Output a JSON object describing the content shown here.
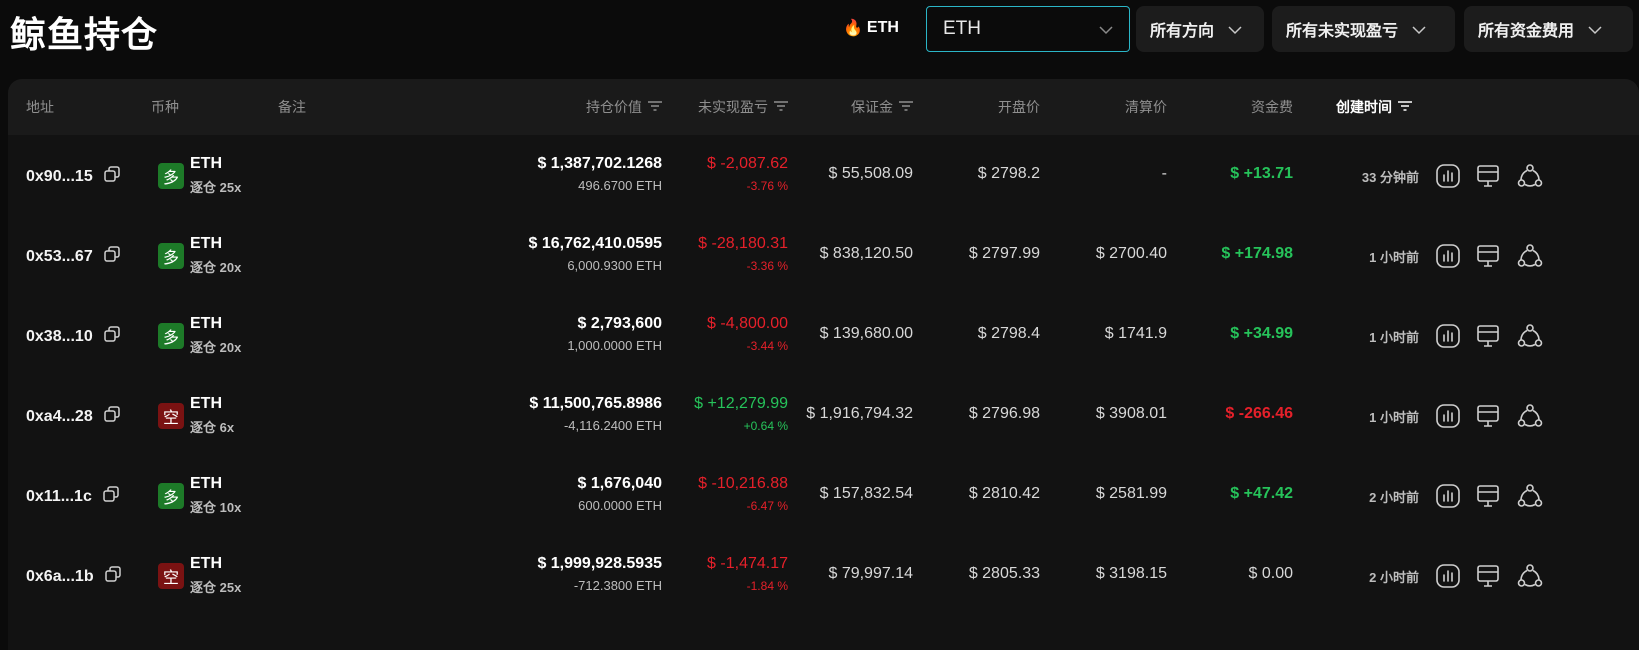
{
  "header": {
    "title": "鲸鱼持仓",
    "hot_coin": "ETH",
    "coin_select_value": "ETH",
    "filters": [
      "所有方向",
      "所有未实现盈亏",
      "所有资金费用"
    ]
  },
  "columns": {
    "address": "地址",
    "coin": "币种",
    "note": "备注",
    "position_value": "持仓价值",
    "unrealized_pnl": "未实现盈亏",
    "margin": "保证金",
    "open_price": "开盘价",
    "liq_price": "清算价",
    "funding": "资金费",
    "created": "创建时间"
  },
  "colors": {
    "accent_border": "#2bb6c7",
    "long": "#1d7a28",
    "short": "#7a1212",
    "positive": "#26c35a",
    "negative": "#e5202a"
  },
  "rows": [
    {
      "address": "0x90...15",
      "side": "多",
      "side_type": "long",
      "coin": "ETH",
      "mode": "逐仓 25x",
      "value": "$ 1,387,702.1268",
      "amount": "496.6700 ETH",
      "pnl": "$ -2,087.62",
      "pnl_pct": "-3.76 %",
      "pnl_sign": "neg",
      "margin": "$ 55,508.09",
      "open": "$ 2798.2",
      "liq": "-",
      "funding": "$ +13.71",
      "funding_sign": "pos",
      "time": "33 分钟前"
    },
    {
      "address": "0x53...67",
      "side": "多",
      "side_type": "long",
      "coin": "ETH",
      "mode": "逐仓 20x",
      "value": "$ 16,762,410.0595",
      "amount": "6,000.9300 ETH",
      "pnl": "$ -28,180.31",
      "pnl_pct": "-3.36 %",
      "pnl_sign": "neg",
      "margin": "$ 838,120.50",
      "open": "$ 2797.99",
      "liq": "$ 2700.40",
      "funding": "$ +174.98",
      "funding_sign": "pos",
      "time": "1 小时前"
    },
    {
      "address": "0x38...10",
      "side": "多",
      "side_type": "long",
      "coin": "ETH",
      "mode": "逐仓 20x",
      "value": "$ 2,793,600",
      "amount": "1,000.0000 ETH",
      "pnl": "$ -4,800.00",
      "pnl_pct": "-3.44 %",
      "pnl_sign": "neg",
      "margin": "$ 139,680.00",
      "open": "$ 2798.4",
      "liq": "$ 1741.9",
      "funding": "$ +34.99",
      "funding_sign": "pos",
      "time": "1 小时前"
    },
    {
      "address": "0xa4...28",
      "side": "空",
      "side_type": "short",
      "coin": "ETH",
      "mode": "逐仓 6x",
      "value": "$ 11,500,765.8986",
      "amount": "-4,116.2400 ETH",
      "pnl": "$ +12,279.99",
      "pnl_pct": "+0.64 %",
      "pnl_sign": "pos",
      "margin": "$ 1,916,794.32",
      "open": "$ 2796.98",
      "liq": "$ 3908.01",
      "funding": "$ -266.46",
      "funding_sign": "neg",
      "time": "1 小时前"
    },
    {
      "address": "0x11...1c",
      "side": "多",
      "side_type": "long",
      "coin": "ETH",
      "mode": "逐仓 10x",
      "value": "$ 1,676,040",
      "amount": "600.0000 ETH",
      "pnl": "$ -10,216.88",
      "pnl_pct": "-6.47 %",
      "pnl_sign": "neg",
      "margin": "$ 157,832.54",
      "open": "$ 2810.42",
      "liq": "$ 2581.99",
      "funding": "$ +47.42",
      "funding_sign": "pos",
      "time": "2 小时前"
    },
    {
      "address": "0x6a...1b",
      "side": "空",
      "side_type": "short",
      "coin": "ETH",
      "mode": "逐仓 25x",
      "value": "$ 1,999,928.5935",
      "amount": "-712.3800 ETH",
      "pnl": "$ -1,474.17",
      "pnl_pct": "-1.84 %",
      "pnl_sign": "neg",
      "margin": "$ 79,997.14",
      "open": "$ 2805.33",
      "liq": "$ 3198.15",
      "funding": "$ 0.00",
      "funding_sign": "neutral",
      "time": "2 小时前"
    }
  ]
}
